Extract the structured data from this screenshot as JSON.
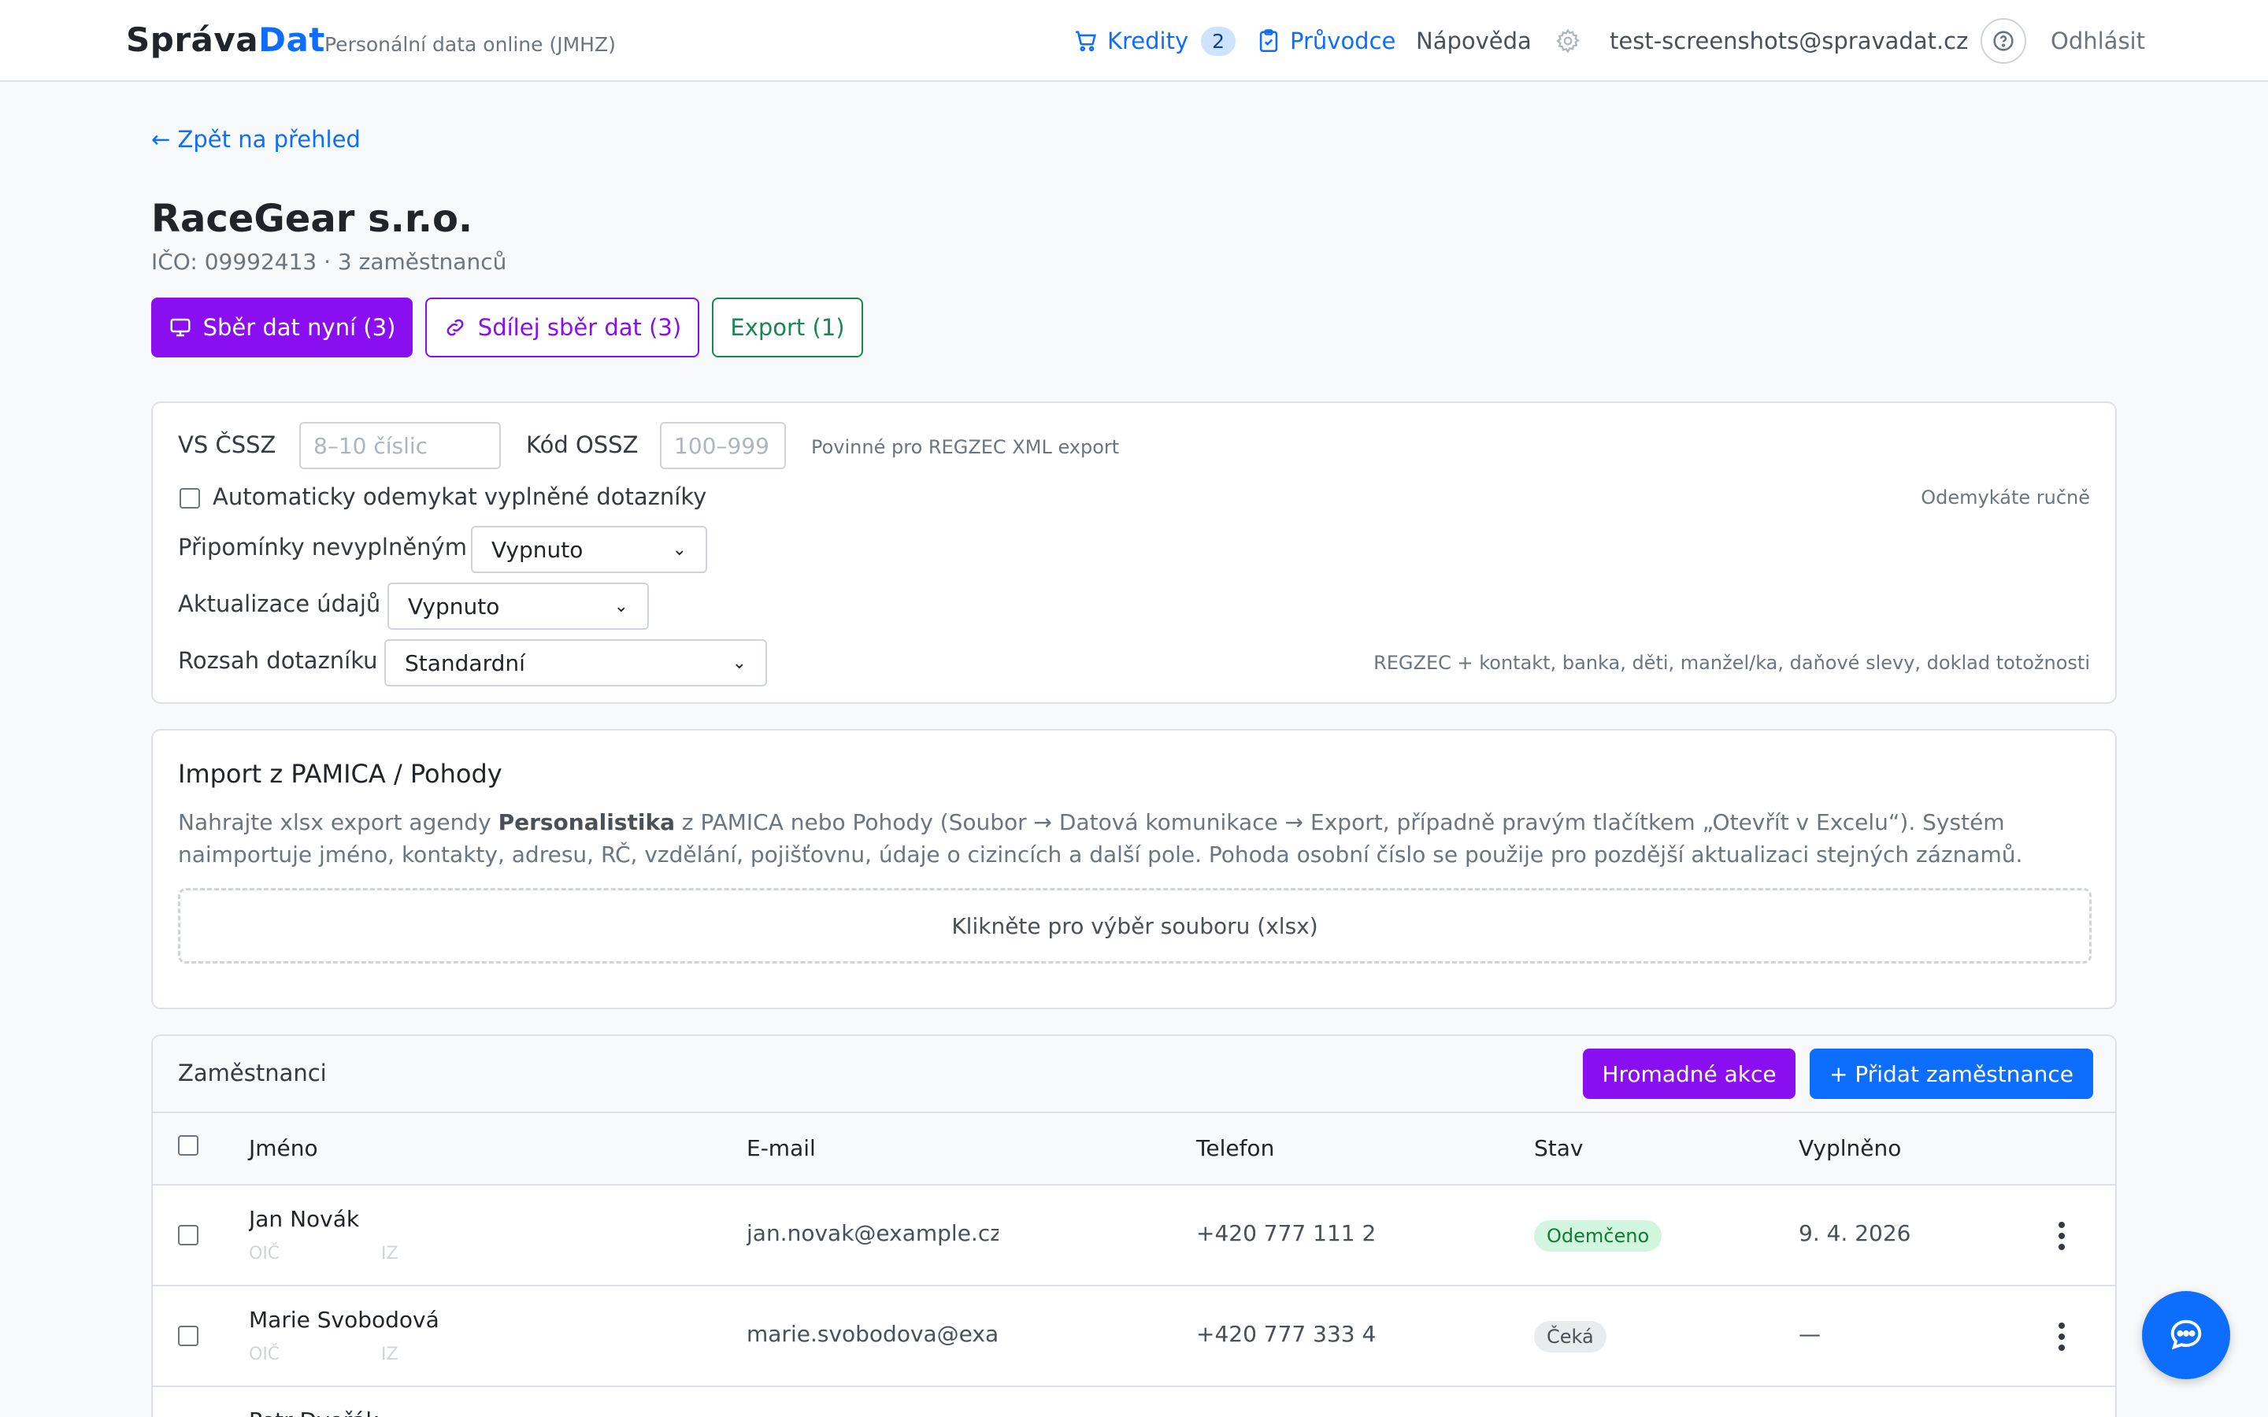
{
  "navbar": {
    "brand_part1": "Správa",
    "brand_part2": "Dat",
    "subtitle": "Personální data online (JMHZ)",
    "credits_label": "Kredity",
    "credits_count": "2",
    "guide_label": "Průvodce",
    "help_label": "Nápověda",
    "user_email": "test-screenshots@spravadat.cz",
    "logout_label": "Odhlásit"
  },
  "page": {
    "back_link": "← Zpět na přehled",
    "company_name": "RaceGear s.r.o.",
    "company_info": "IČO: 09992413 · 3 zaměstnanců"
  },
  "actions": {
    "collect_now": "Sběr dat nyní (3)",
    "share_collect": "Sdílej sběr dat (3)",
    "export": "Export (1)"
  },
  "settings": {
    "vs_cssz_label": "VS ČSSZ",
    "vs_cssz_placeholder": "8–10 číslic",
    "kod_ossz_label": "Kód OSSZ",
    "kod_ossz_placeholder": "100–999",
    "required_hint": "Povinné pro REGZEC XML export",
    "auto_unlock_label": "Automaticky odemykat vyplněné dotazníky",
    "auto_unlock_hint": "Odemykáte ručně",
    "reminders_label": "Připomínky nevyplněným",
    "reminders_value": "Vypnuto",
    "updates_label": "Aktualizace údajů",
    "updates_value": "Vypnuto",
    "scope_label": "Rozsah dotazníku",
    "scope_value": "Standardní",
    "scope_hint": "REGZEC + kontakt, banka, děti, manžel/ka, daňové slevy, doklad totožnosti"
  },
  "import": {
    "title": "Import z PAMICA / Pohody",
    "text_before": "Nahrajte xlsx export agendy ",
    "text_bold": "Personalistika",
    "text_after": " z PAMICA nebo Pohody (Soubor → Datová komunikace → Export, případně pravým tlačítkem „Otevřít v Excelu“). Systém naimportuje jméno, kontakty, adresu, RČ, vzdělání, pojišťovnu, údaje o cizincích a další pole. Pohoda osobní číslo se použije pro pozdější aktualizaci stejných záznamů.",
    "dropzone": "Klikněte pro výběr souboru (xlsx)"
  },
  "employees": {
    "title": "Zaměstnanci",
    "bulk_actions": "Hromadné akce",
    "add_employee": "+ Přidat zaměstnance",
    "columns": [
      "Jméno",
      "E-mail",
      "Telefon",
      "Stav",
      "Vyplněno"
    ],
    "rows": [
      {
        "name": "Jan Novák",
        "sub1": "OIČ",
        "sub2": "IZ",
        "email": "jan.novak@example.cz",
        "phone": "+420 777 111 2",
        "status": "Odemčeno",
        "filled": "9. 4. 2026"
      },
      {
        "name": "Marie Svobodová",
        "sub1": "OIČ",
        "sub2": "IZ",
        "email": "marie.svobodova@exa",
        "phone": "+420 777 333 4",
        "status": "Čeká",
        "filled": "—"
      },
      {
        "name": "Petr Dvořák",
        "sub1": "",
        "sub2": "",
        "email": "",
        "phone": "",
        "status": "",
        "filled": ""
      }
    ]
  },
  "icons": {
    "cart": "cart-icon",
    "clipboard": "clipboard-check-icon",
    "gear": "gear-icon",
    "help": "help-circle-icon",
    "chat": "chat-icon",
    "monitor": "monitor-icon",
    "link": "link-icon"
  },
  "colors": {
    "primary": "#0d6efd",
    "purple": "#8a0ff0",
    "green": "#198754"
  }
}
